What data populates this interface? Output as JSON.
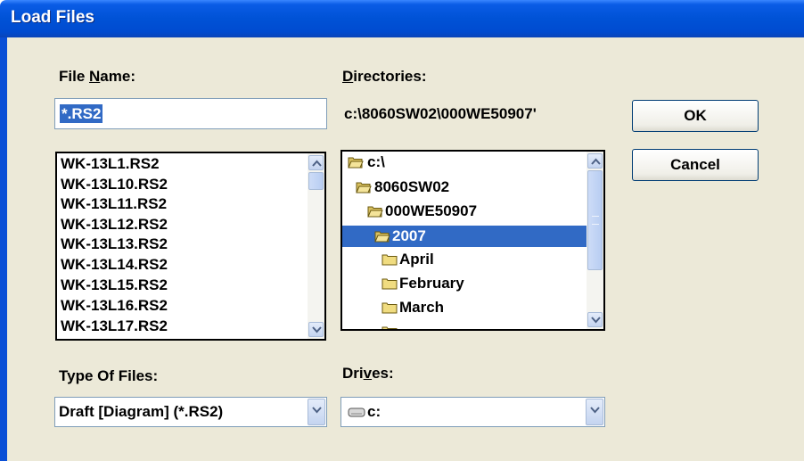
{
  "window": {
    "title": "Load Files"
  },
  "file_name": {
    "label_before": "File ",
    "label_underlined": "N",
    "label_after": "ame:",
    "value": "*.RS2"
  },
  "directories": {
    "label_underlined": "D",
    "label_after": "irectories:",
    "current_path": "c:\\8060SW02\\000WE50907'",
    "items": [
      {
        "name": "c:\\",
        "selected": false
      },
      {
        "name": "8060SW02",
        "selected": false
      },
      {
        "name": "000WE50907",
        "selected": false
      },
      {
        "name": "2007",
        "selected": true
      },
      {
        "name": "April",
        "selected": false
      },
      {
        "name": "February",
        "selected": false
      },
      {
        "name": "March",
        "selected": false
      }
    ]
  },
  "files": {
    "items": [
      "WK-13L1.RS2",
      "WK-13L10.RS2",
      "WK-13L11.RS2",
      "WK-13L12.RS2",
      "WK-13L13.RS2",
      "WK-13L14.RS2",
      "WK-13L15.RS2",
      "WK-13L16.RS2",
      "WK-13L17.RS2"
    ]
  },
  "type_of_files": {
    "label": "Type Of Files:",
    "value": "Draft [Diagram]  (*.RS2)"
  },
  "drives": {
    "label_before": "Dri",
    "label_underlined": "v",
    "label_after": "es:",
    "value": "c:"
  },
  "buttons": {
    "ok": "OK",
    "cancel": "Cancel"
  },
  "colors": {
    "title_bar": "#0052d6",
    "dialog_bg": "#ece9d8",
    "selection": "#316ac5"
  }
}
